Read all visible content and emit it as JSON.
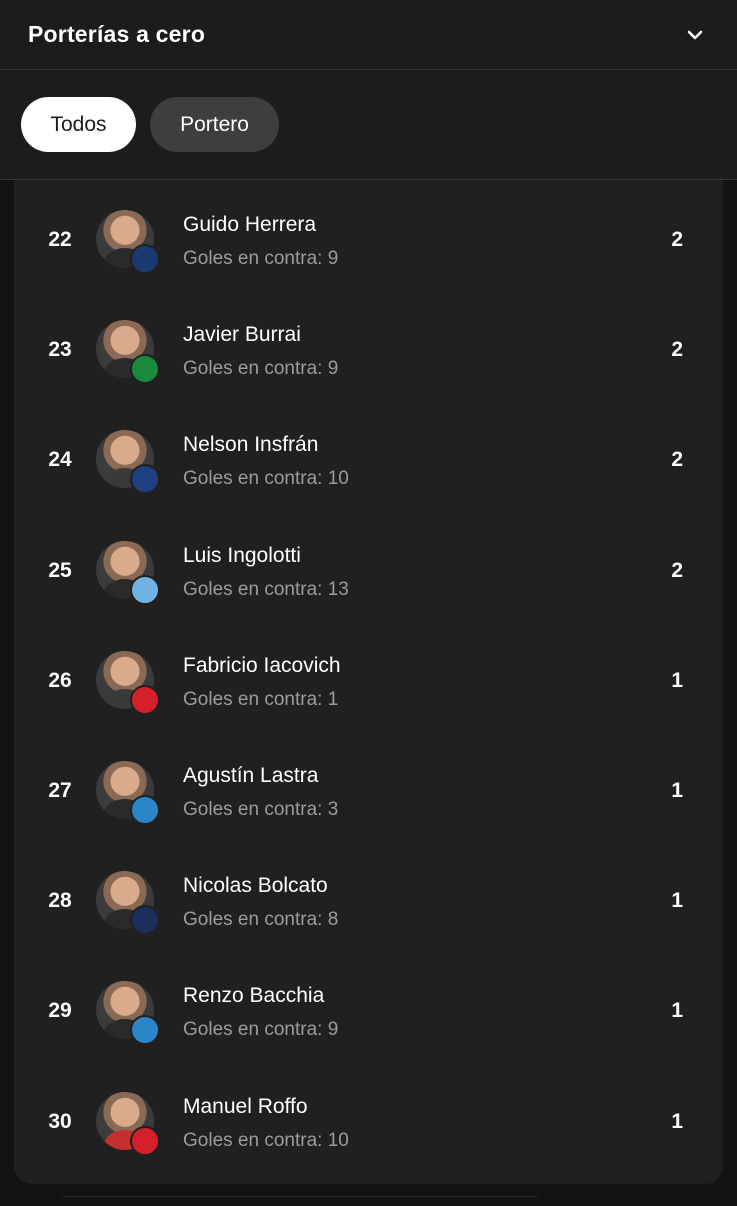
{
  "header": {
    "title": "Porterías a cero",
    "expand_icon": "chevron-down-icon"
  },
  "filters": [
    {
      "label": "Todos",
      "active": true
    },
    {
      "label": "Portero",
      "active": false
    }
  ],
  "players": [
    {
      "rank": "22",
      "name": "Guido Herrera",
      "sub": "Goles en contra: 9",
      "value": "2",
      "badge_label": "C.A.T",
      "badge_color": "#1b3a73",
      "shirt_color": "#2a2a2a"
    },
    {
      "rank": "23",
      "name": "Javier Burrai",
      "sub": "Goles en contra: 9",
      "value": "2",
      "badge_label": "CSA",
      "badge_color": "#1a8a3c",
      "shirt_color": "#2a2a2a"
    },
    {
      "rank": "24",
      "name": "Nelson Insfrán",
      "sub": "Goles en contra: 10",
      "value": "2",
      "badge_label": "GLP",
      "badge_color": "#1e3f80",
      "shirt_color": "#3a3a3a"
    },
    {
      "rank": "25",
      "name": "Luis Ingolotti",
      "sub": "Goles en contra: 13",
      "value": "2",
      "badge_label": "C.A.T",
      "badge_color": "#6fb2e3",
      "shirt_color": "#2a2a2a"
    },
    {
      "rank": "26",
      "name": "Fabricio Iacovich",
      "sub": "Goles en contra: 1",
      "value": "1",
      "badge_label": "CDLP",
      "badge_color": "#d4202a",
      "shirt_color": "#3a3a3a"
    },
    {
      "rank": "27",
      "name": "Agustín Lastra",
      "sub": "Goles en contra: 3",
      "value": "1",
      "badge_label": "AAT",
      "badge_color": "#2a86c9",
      "shirt_color": "#2a2a2a"
    },
    {
      "rank": "28",
      "name": "Nicolas Bolcato",
      "sub": "Goles en contra: 8",
      "value": "1",
      "badge_label": "CAI",
      "badge_color": "#1c2e5c",
      "shirt_color": "#2a2a2a"
    },
    {
      "rank": "29",
      "name": "Renzo Bacchia",
      "sub": "Goles en contra: 9",
      "value": "1",
      "badge_label": "AAT",
      "badge_color": "#2a86c9",
      "shirt_color": "#2a2a2a"
    },
    {
      "rank": "30",
      "name": "Manuel Roffo",
      "sub": "Goles en contra: 10",
      "value": "1",
      "badge_label": "CAU",
      "badge_color": "#d4202a",
      "shirt_color": "#c43030"
    }
  ]
}
